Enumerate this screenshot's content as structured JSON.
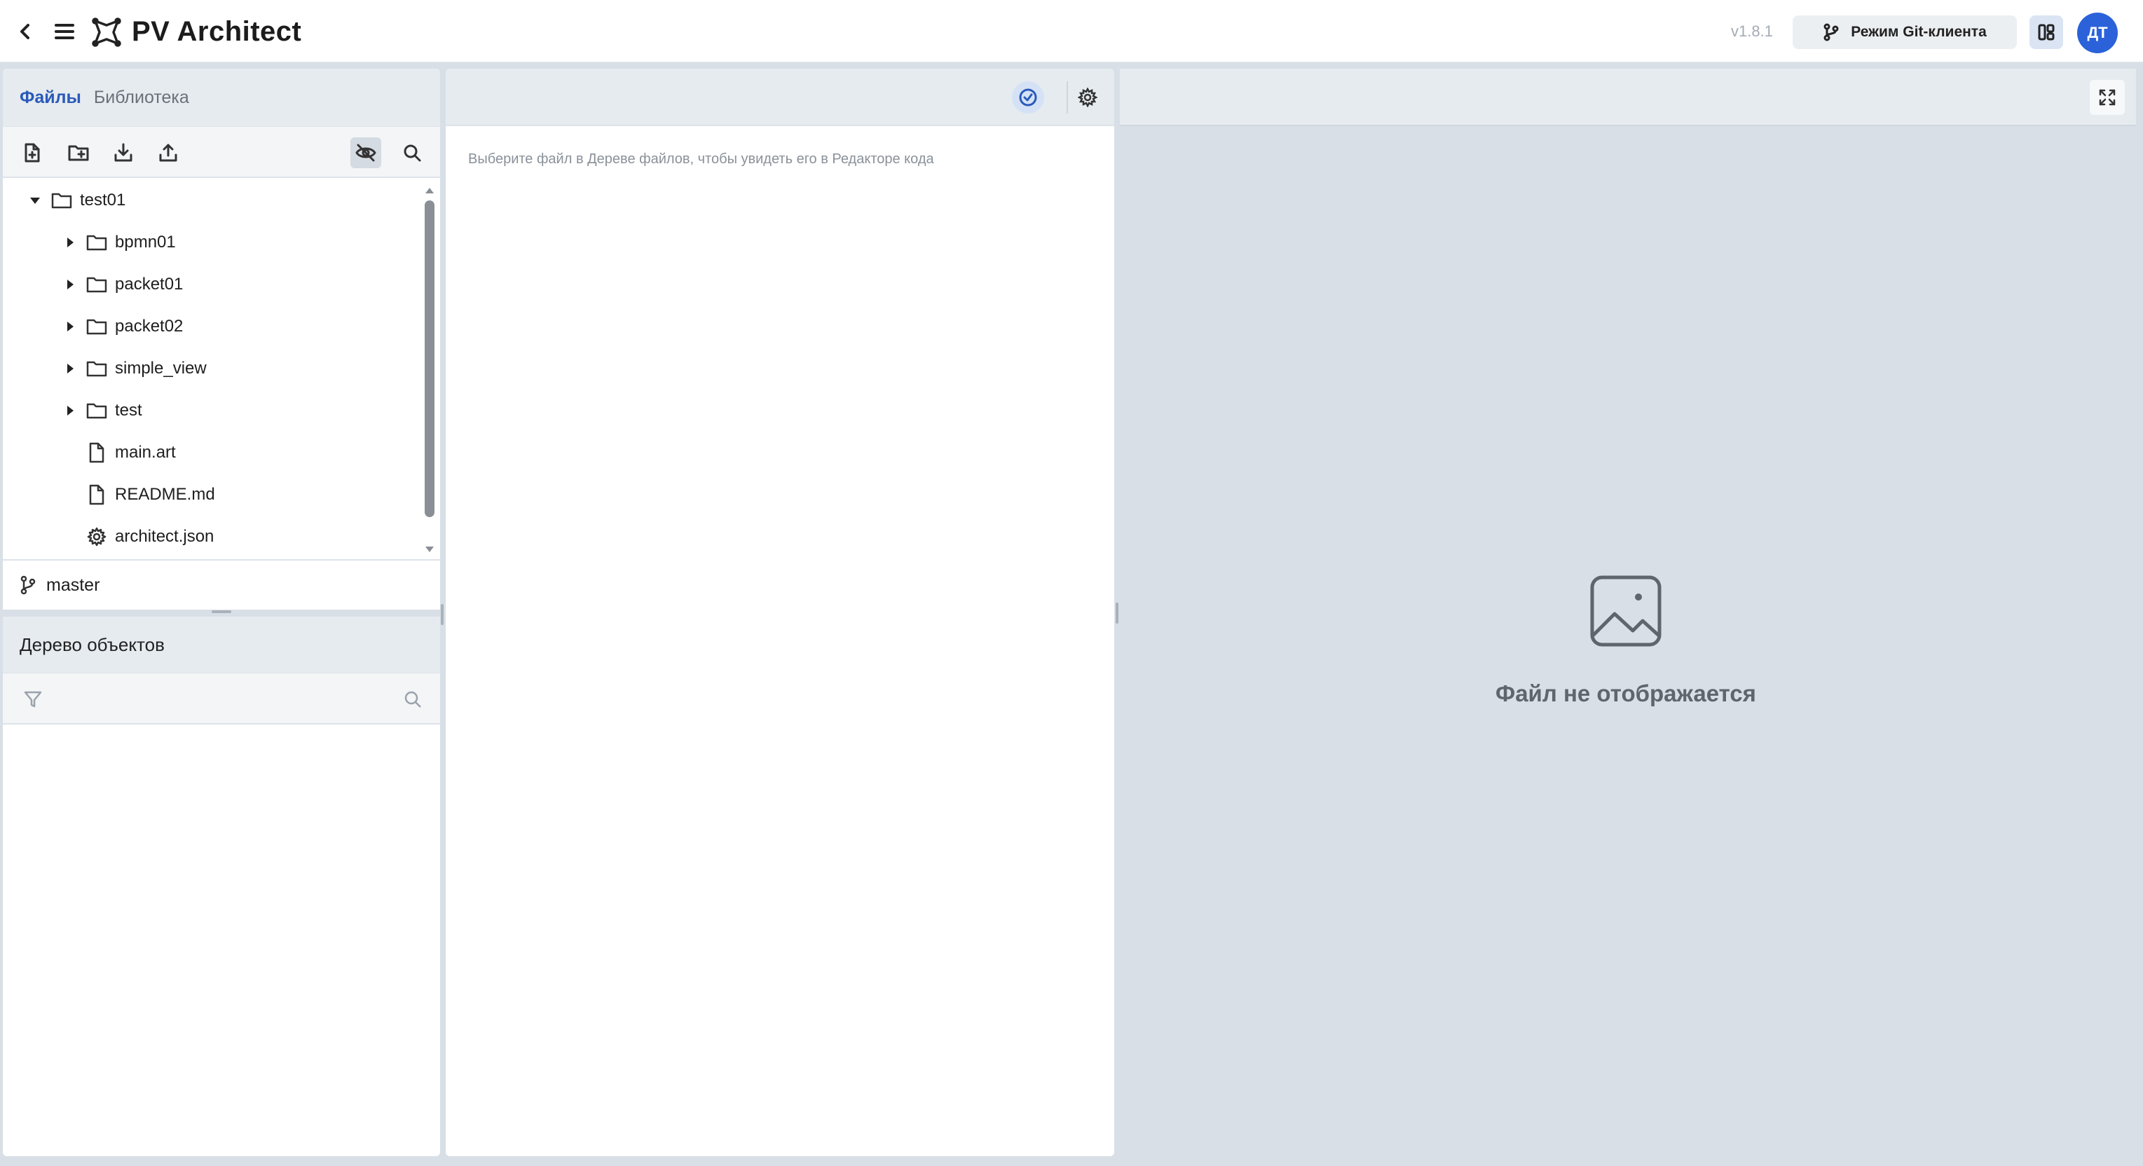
{
  "header": {
    "app_title": "PV Architect",
    "version": "v1.8.1",
    "git_mode_label": "Режим Git-клиента",
    "avatar_initials": "ДТ"
  },
  "files_panel": {
    "tabs": [
      {
        "label": "Файлы",
        "active": true
      },
      {
        "label": "Библиотека",
        "active": false
      }
    ],
    "toolbar_icons": [
      "new-file-icon",
      "new-folder-icon",
      "download-icon",
      "upload-icon",
      "eye-off-icon",
      "search-icon"
    ],
    "tree": [
      {
        "label": "test01",
        "type": "folder",
        "expanded": true,
        "depth": 0
      },
      {
        "label": "bpmn01",
        "type": "folder",
        "expanded": false,
        "depth": 1
      },
      {
        "label": "packet01",
        "type": "folder",
        "expanded": false,
        "depth": 1
      },
      {
        "label": "packet02",
        "type": "folder",
        "expanded": false,
        "depth": 1
      },
      {
        "label": "simple_view",
        "type": "folder",
        "expanded": false,
        "depth": 1
      },
      {
        "label": "test",
        "type": "folder",
        "expanded": false,
        "depth": 1
      },
      {
        "label": "main.art",
        "type": "file",
        "depth": 1
      },
      {
        "label": "README.md",
        "type": "file",
        "depth": 1
      },
      {
        "label": "architect.json",
        "type": "settings",
        "depth": 1
      }
    ],
    "branch": "master"
  },
  "objects_panel": {
    "title": "Дерево объектов",
    "filter_placeholder": "",
    "filter_value": ""
  },
  "editor": {
    "hint": "Выберите файл в Дереве файлов, чтобы увидеть его в Редакторе кода"
  },
  "preview": {
    "empty_text": "Файл не отображается"
  },
  "colors": {
    "accent": "#2a5ab8",
    "avatar_bg": "#2b62d9",
    "panel_header": "#e6ebf0",
    "preview_bg": "#d8dfe6"
  }
}
